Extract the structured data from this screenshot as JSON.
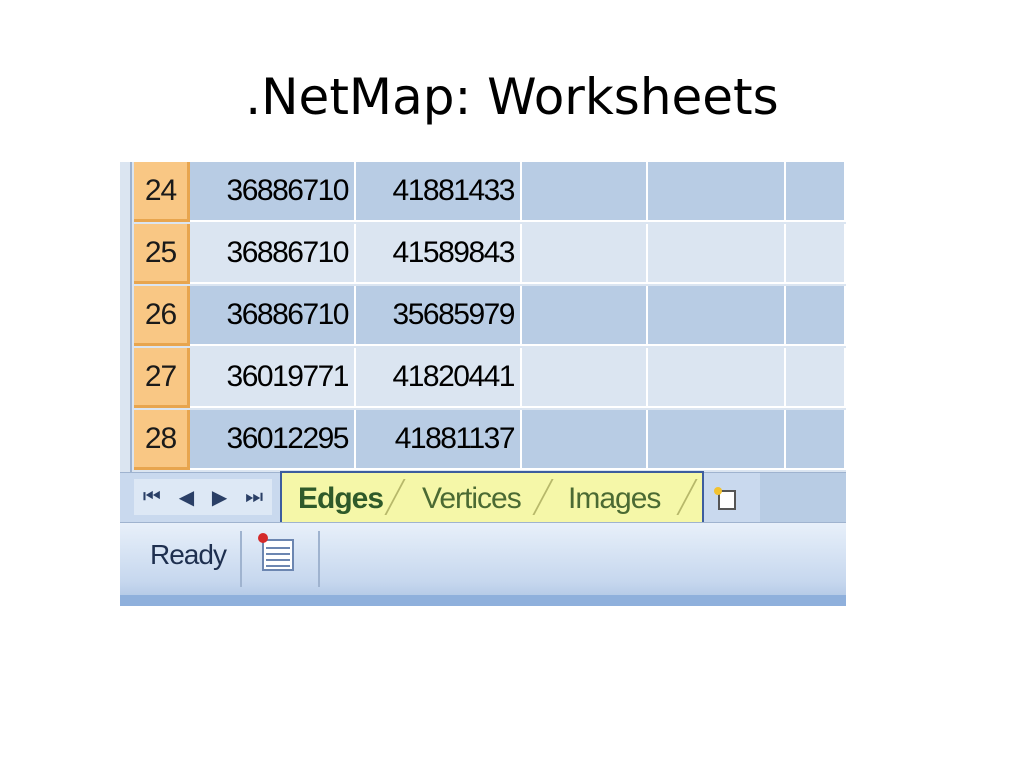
{
  "slide": {
    "title": ".NetMap: Worksheets"
  },
  "grid": {
    "rows": [
      {
        "number": "24",
        "col1": "36886710",
        "col2": "41881433"
      },
      {
        "number": "25",
        "col1": "36886710",
        "col2": "41589843"
      },
      {
        "number": "26",
        "col1": "36886710",
        "col2": "35685979"
      },
      {
        "number": "27",
        "col1": "36019771",
        "col2": "41820441"
      },
      {
        "number": "28",
        "col1": "36012295",
        "col2": "41881137"
      }
    ]
  },
  "tabbar": {
    "nav": {
      "first": "⏮",
      "prev": "◀",
      "next": "▶",
      "last": "⏭"
    },
    "tabs": [
      {
        "label": "Edges",
        "active": true
      },
      {
        "label": "Vertices",
        "active": false
      },
      {
        "label": "Images",
        "active": false
      }
    ],
    "new_sheet_icon": "new-sheet-icon"
  },
  "statusbar": {
    "status": "Ready",
    "macro_icon": "macro-record-icon"
  },
  "colors": {
    "row_header": "#f9c784",
    "cell_dark": "#b8cce4",
    "cell_light": "#dbe5f1",
    "tab_highlight": "#f5f7a8",
    "highlight_border": "#3d5d9e"
  }
}
